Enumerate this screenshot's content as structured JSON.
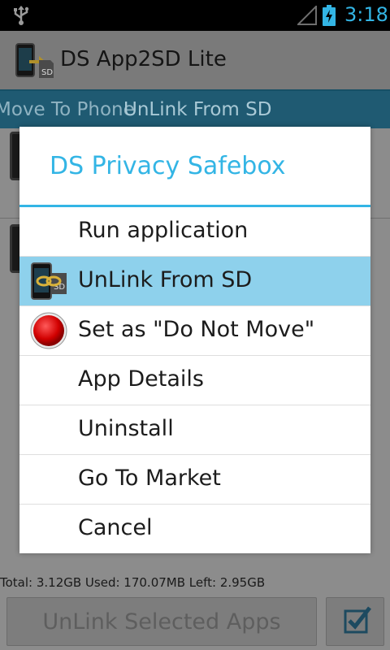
{
  "status_bar": {
    "time": "3:18",
    "icons": [
      "usb-icon",
      "signal-icon",
      "battery-charging-icon"
    ],
    "accent_color": "#33b5e5"
  },
  "app": {
    "title": "DS App2SD Lite",
    "tabs": [
      {
        "label": "Move To Phone"
      },
      {
        "label": "UnLink From SD"
      }
    ],
    "storage_text": "Total: 3.12GB Used: 170.07MB Left: 2.95GB",
    "bottom_button": "UnLink Selected Apps"
  },
  "dialog": {
    "title": "DS Privacy Safebox",
    "title_color": "#33b5e5",
    "selected_color": "#8ed1ec",
    "items": [
      {
        "label": "Run application",
        "icon": ""
      },
      {
        "label": "UnLink From SD",
        "icon": "unlink-sd-icon",
        "selected": true
      },
      {
        "label": "Set as \"Do Not Move\"",
        "icon": "red-circle-icon"
      },
      {
        "label": "App Details",
        "icon": ""
      },
      {
        "label": "Uninstall",
        "icon": ""
      },
      {
        "label": "Go To Market",
        "icon": ""
      },
      {
        "label": "Cancel",
        "icon": ""
      }
    ]
  }
}
